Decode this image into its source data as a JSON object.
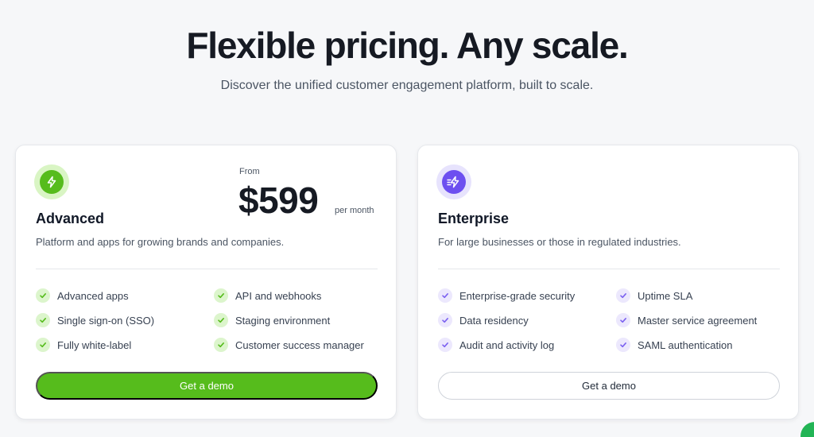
{
  "hero": {
    "title": "Flexible pricing. Any scale.",
    "subtitle": "Discover the unified customer engagement platform, built to scale."
  },
  "plans": [
    {
      "name": "Advanced",
      "description": "Platform and apps for growing brands and companies.",
      "icon": "lightning-icon",
      "accent": "#56bc1c",
      "price": {
        "from_label": "From",
        "amount": "$599",
        "period": "per month"
      },
      "features": [
        "Advanced apps",
        "API and webhooks",
        "Single sign-on (SSO)",
        "Staging environment",
        "Fully white-label",
        "Customer success manager"
      ],
      "cta_label": "Get a demo"
    },
    {
      "name": "Enterprise",
      "description": "For large businesses or those in regulated industries.",
      "icon": "fast-lightning-icon",
      "accent": "#6d4ff0",
      "features": [
        "Enterprise-grade security",
        "Uptime SLA",
        "Data residency",
        "Master service agreement",
        "Audit and activity log",
        "SAML authentication"
      ],
      "cta_label": "Get a demo"
    }
  ]
}
